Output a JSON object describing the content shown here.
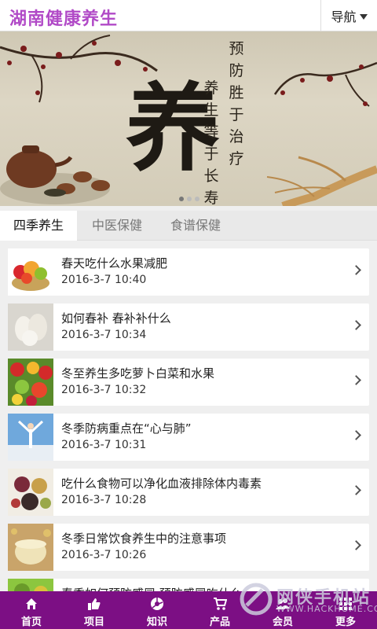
{
  "header": {
    "title": "湖南健康养生",
    "nav_label": "导航"
  },
  "banner": {
    "big_char": "养",
    "col1": "养生等于长寿",
    "col2": "预防胜于治疗"
  },
  "tabs": [
    {
      "label": "四季养生",
      "active": true
    },
    {
      "label": "中医保健",
      "active": false
    },
    {
      "label": "食谱保健",
      "active": false
    }
  ],
  "articles": [
    {
      "title": "春天吃什么水果减肥",
      "time": "2016-3-7 10:40",
      "thumb": "fruit-bowl"
    },
    {
      "title": "如何春补 春补补什么",
      "time": "2016-3-7 10:34",
      "thumb": "garlic"
    },
    {
      "title": "冬至养生多吃萝卜白菜和水果",
      "time": "2016-3-7 10:32",
      "thumb": "fruit-mix"
    },
    {
      "title": "冬季防病重点在“心与肺”",
      "time": "2016-3-7 10:31",
      "thumb": "outdoor-stretch"
    },
    {
      "title": "吃什么食物可以净化血液排除体内毒素",
      "time": "2016-3-7 10:28",
      "thumb": "grains"
    },
    {
      "title": "冬季日常饮食养生中的注意事项",
      "time": "2016-3-7 10:26",
      "thumb": "soy-milk"
    },
    {
      "title": "春季如何预防感冒 预防感冒吃什么",
      "time": "",
      "thumb": "fruit-partial"
    }
  ],
  "bottom_nav": [
    {
      "label": "首页",
      "icon": "home-icon"
    },
    {
      "label": "项目",
      "icon": "thumbs-up-icon"
    },
    {
      "label": "知识",
      "icon": "aperture-icon"
    },
    {
      "label": "产品",
      "icon": "cart-icon"
    },
    {
      "label": "会员",
      "icon": "users-icon"
    },
    {
      "label": "更多",
      "icon": "grid-icon"
    }
  ],
  "watermark": {
    "text": "网侠手机站",
    "sub": "WWW.HACKHOME.COM"
  },
  "colors": {
    "brand": "#b14ac7",
    "bottom_bar": "#7c0f84"
  }
}
